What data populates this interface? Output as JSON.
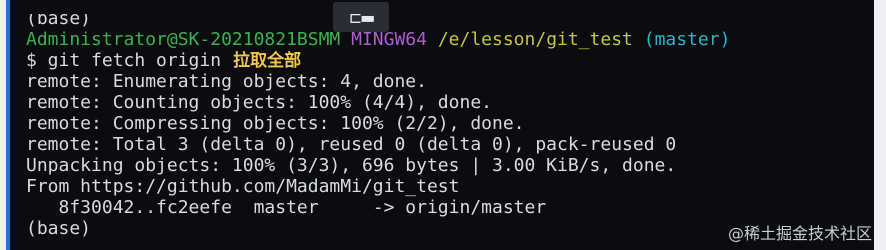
{
  "terminal": {
    "prev_prompt": "(base)",
    "prompt": {
      "user_host": "Administrator@SK-20210821BSMM",
      "system": "MINGW64",
      "path": "/e/lesson/git_test",
      "branch": "(master)"
    },
    "command": "$ git fetch origin",
    "annotation": "拉取全部",
    "output": [
      "remote: Enumerating objects: 4, done.",
      "remote: Counting objects: 100% (4/4), done.",
      "remote: Compressing objects: 100% (2/2), done.",
      "remote: Total 3 (delta 0), reused 0 (delta 0), pack-reused 0",
      "Unpacking objects: 100% (3/3), 696 bytes | 3.00 KiB/s, done.",
      "From https://github.com/MadamMi/git_test",
      "   8f30042..fc2eefe  master     -> origin/master"
    ],
    "next_prompt": "(base)"
  },
  "overlay": {
    "icon": "toggle-icon"
  },
  "watermark": "@稀土掘金技术社区",
  "colors": {
    "background": "#0a0c10",
    "user_host": "#37b34a",
    "system": "#b05bd0",
    "path": "#c6c43a",
    "branch": "#2ab3c7",
    "annotation": "#f3c44a",
    "accent_bar": "#1c74e6"
  }
}
